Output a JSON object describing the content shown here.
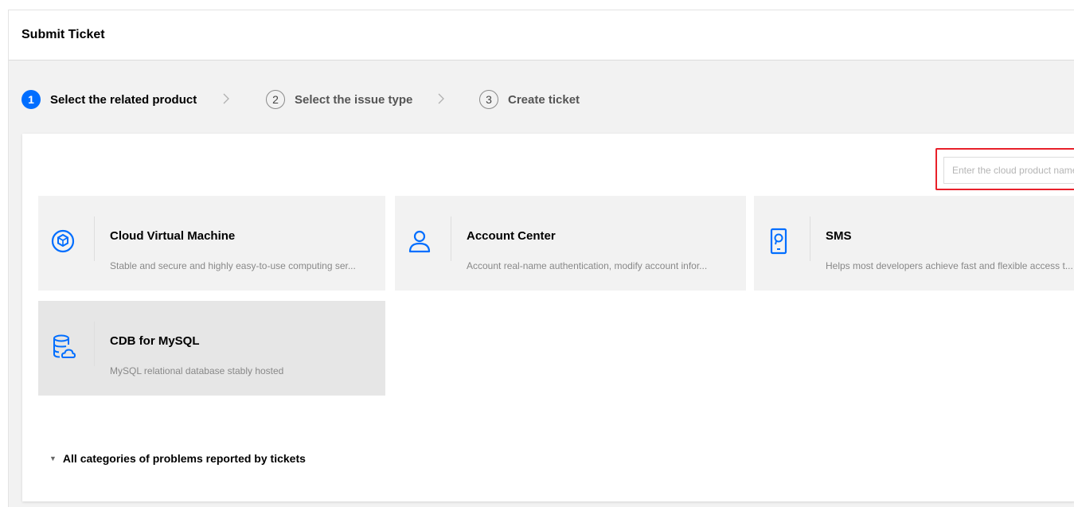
{
  "header": {
    "title": "Submit Ticket"
  },
  "steps": [
    {
      "number": "1",
      "label": "Select the related product",
      "state": "active"
    },
    {
      "number": "2",
      "label": "Select the issue type",
      "state": "inactive"
    },
    {
      "number": "3",
      "label": "Create ticket",
      "state": "inactive"
    }
  ],
  "search": {
    "placeholder": "Enter the cloud product name",
    "value": ""
  },
  "products": [
    {
      "name": "Cloud Virtual Machine",
      "description": "Stable and secure and highly easy-to-use computing ser...",
      "icon": "cloud-virtual-machine-icon"
    },
    {
      "name": "Account Center",
      "description": "Account real-name authentication, modify account infor...",
      "icon": "user-icon"
    },
    {
      "name": "SMS",
      "description": "Helps most developers achieve fast and flexible access t...",
      "icon": "sms-icon"
    },
    {
      "name": "CDB for MySQL",
      "description": "MySQL relational database stably hosted",
      "icon": "database-icon"
    }
  ],
  "categories": {
    "label": "All categories of problems reported by tickets"
  },
  "colors": {
    "accent": "#006eff",
    "highlight": "#e8202a",
    "card_bg": "#f2f2f2"
  }
}
